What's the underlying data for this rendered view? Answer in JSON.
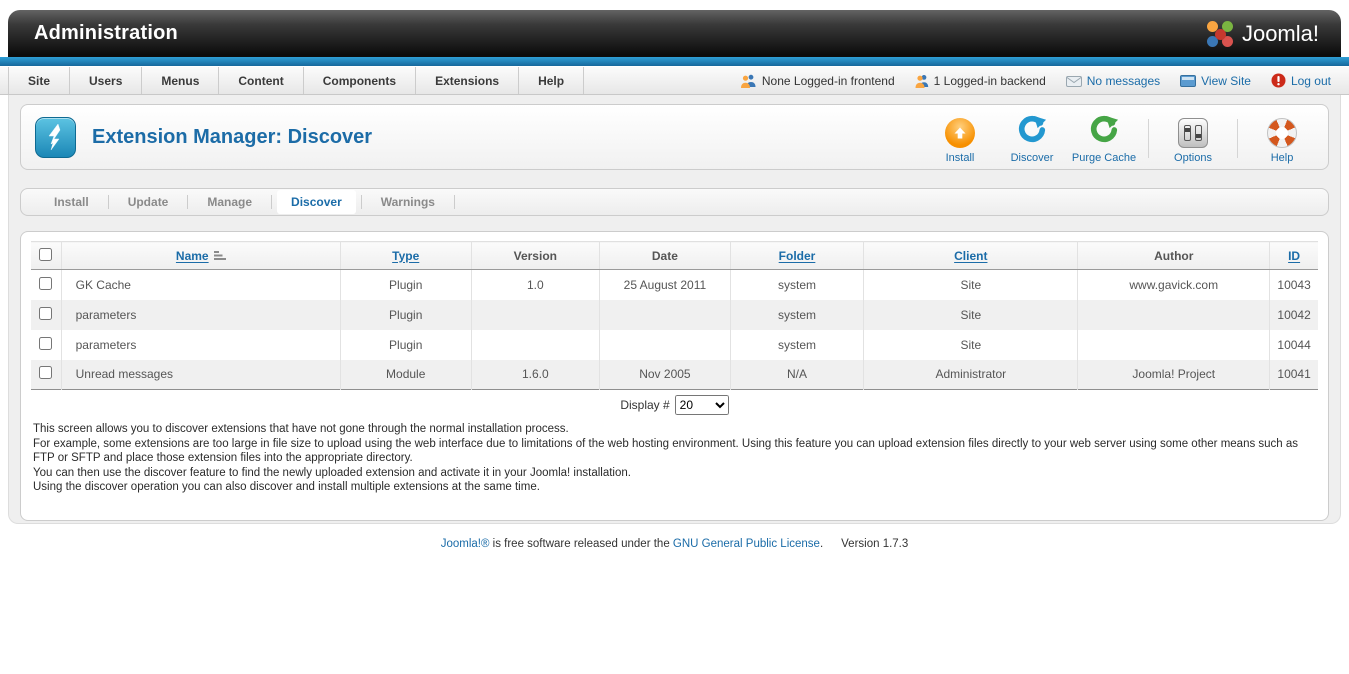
{
  "header": {
    "title": "Administration",
    "logo_text": "Joomla!"
  },
  "menubar": {
    "items": [
      "Site",
      "Users",
      "Menus",
      "Content",
      "Components",
      "Extensions",
      "Help"
    ],
    "status": {
      "frontend": "None Logged-in frontend",
      "backend": "1 Logged-in backend",
      "messages": "No messages",
      "view_site": "View Site",
      "logout": "Log out"
    }
  },
  "page": {
    "title": "Extension Manager: Discover",
    "icon": "lightning-icon"
  },
  "toolbar": {
    "buttons": [
      {
        "label": "Install",
        "icon": "arrow-up-circle-orange"
      },
      {
        "label": "Discover",
        "icon": "refresh-circle-blue"
      },
      {
        "label": "Purge Cache",
        "icon": "refresh-circle-green"
      },
      {
        "label": "Options",
        "icon": "sliders-panel-gray"
      },
      {
        "label": "Help",
        "icon": "lifebuoy-orange"
      }
    ]
  },
  "tabs": [
    {
      "label": "Install",
      "active": false
    },
    {
      "label": "Update",
      "active": false
    },
    {
      "label": "Manage",
      "active": false
    },
    {
      "label": "Discover",
      "active": true
    },
    {
      "label": "Warnings",
      "active": false
    }
  ],
  "table": {
    "columns": [
      {
        "label": "Name",
        "sortable": true,
        "sorted": "asc"
      },
      {
        "label": "Type",
        "sortable": true
      },
      {
        "label": "Version",
        "sortable": false
      },
      {
        "label": "Date",
        "sortable": false
      },
      {
        "label": "Folder",
        "sortable": true
      },
      {
        "label": "Client",
        "sortable": true
      },
      {
        "label": "Author",
        "sortable": false
      },
      {
        "label": "ID",
        "sortable": true
      }
    ],
    "rows": [
      {
        "name": "GK Cache",
        "type": "Plugin",
        "version": "1.0",
        "date": "25 August 2011",
        "folder": "system",
        "client": "Site",
        "author": "www.gavick.com",
        "id": "10043"
      },
      {
        "name": "parameters",
        "type": "Plugin",
        "version": "",
        "date": "",
        "folder": "system",
        "client": "Site",
        "author": "",
        "id": "10042"
      },
      {
        "name": "parameters",
        "type": "Plugin",
        "version": "",
        "date": "",
        "folder": "system",
        "client": "Site",
        "author": "",
        "id": "10044"
      },
      {
        "name": "Unread messages",
        "type": "Module",
        "version": "1.6.0",
        "date": "Nov 2005",
        "folder": "N/A",
        "client": "Administrator",
        "author": "Joomla! Project",
        "id": "10041"
      }
    ]
  },
  "pagination": {
    "label": "Display #",
    "value": "20"
  },
  "description": {
    "lines": [
      "This screen allows you to discover extensions that have not gone through the normal installation process.",
      "For example, some extensions are too large in file size to upload using the web interface due to limitations of the web hosting environment. Using this feature you can upload extension files directly to your web server using some other means such as FTP or SFTP and place those extension files into the appropriate directory.",
      "You can then use the discover feature to find the newly uploaded extension and activate it in your Joomla! installation.",
      "Using the discover operation you can also discover and install multiple extensions at the same time."
    ]
  },
  "footer": {
    "link1": "Joomla!®",
    "text_mid": " is free software released under the ",
    "link2": "GNU General Public License",
    "period": ".",
    "version": "Version 1.7.3"
  },
  "colors": {
    "link_blue": "#1b6ca8",
    "strip_blue_top": "#2e9fd6",
    "strip_blue_bottom": "#16689c",
    "install_orange": "#f79000",
    "discover_blue": "#2398d0",
    "purge_green": "#46a546",
    "logout_red": "#cc2a19"
  }
}
